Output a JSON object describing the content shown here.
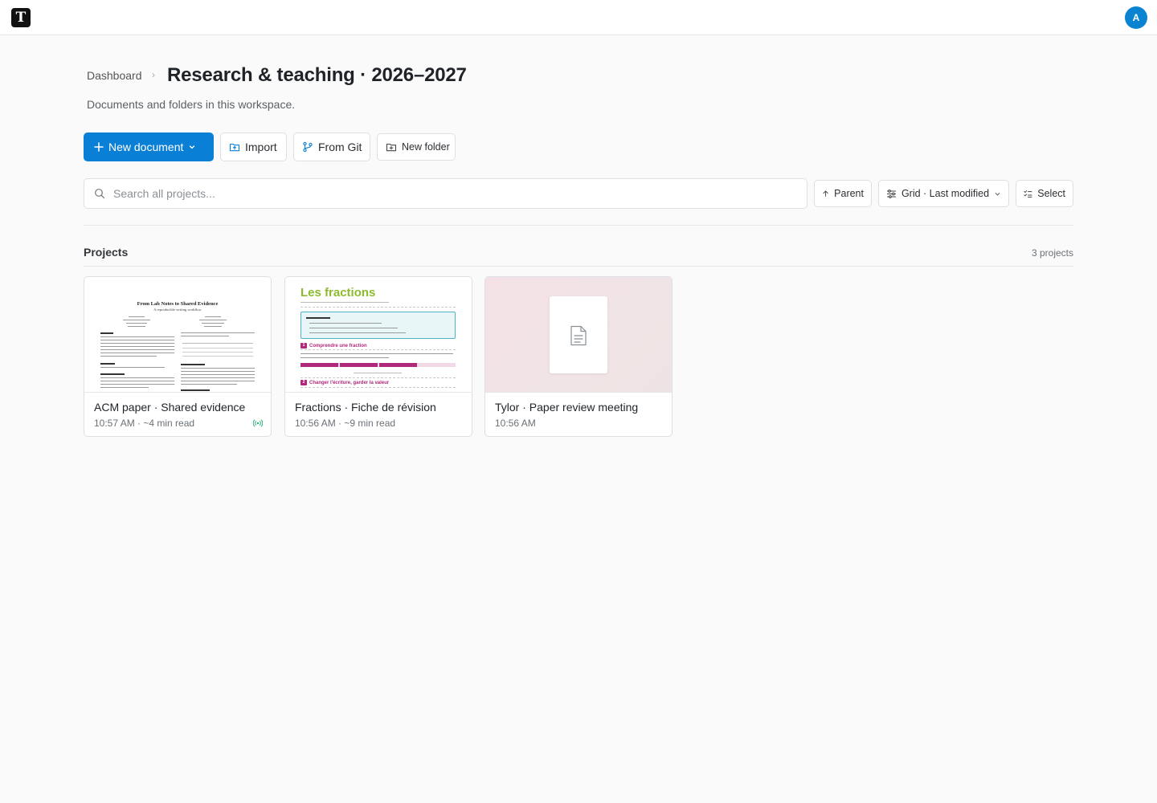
{
  "app": {
    "logo_letter": "T",
    "avatar_initial": "A"
  },
  "breadcrumb": {
    "parent": "Dashboard",
    "separator": "›"
  },
  "page": {
    "title": "Research & teaching · 2026–2027",
    "subtitle": "Documents and folders in this workspace."
  },
  "actions": {
    "new_document": "New document",
    "import": "Import",
    "from_git": "From Git",
    "new_folder": "New folder"
  },
  "search": {
    "placeholder": "Search all projects..."
  },
  "toolbar": {
    "parent": "Parent",
    "view": "Grid · Last modified",
    "select": "Select"
  },
  "projects": {
    "heading": "Projects",
    "count": "3 projects",
    "items": [
      {
        "title": "ACM paper · Shared evidence",
        "meta": "10:57 AM · ~4 min read",
        "thumb_title": "From Lab Notes to Shared Evidence",
        "thumb_subtitle": "A reproducible writing workflow"
      },
      {
        "title": "Fractions · Fiche de révision",
        "meta": "10:56 AM · ~9 min read",
        "thumb_title": "Les fractions",
        "thumb_section1": "Comprendre une fraction",
        "thumb_section2": "Changer l'écriture, garder la valeur"
      },
      {
        "title": "Tylor · Paper review meeting",
        "meta": "10:56 AM"
      }
    ]
  },
  "colors": {
    "primary": "#0a7fd6",
    "avatar": "#0a84d0",
    "live_indicator": "#2fb37a",
    "fraction_title": "#8dbb2e",
    "fraction_accent": "#b0287a"
  }
}
